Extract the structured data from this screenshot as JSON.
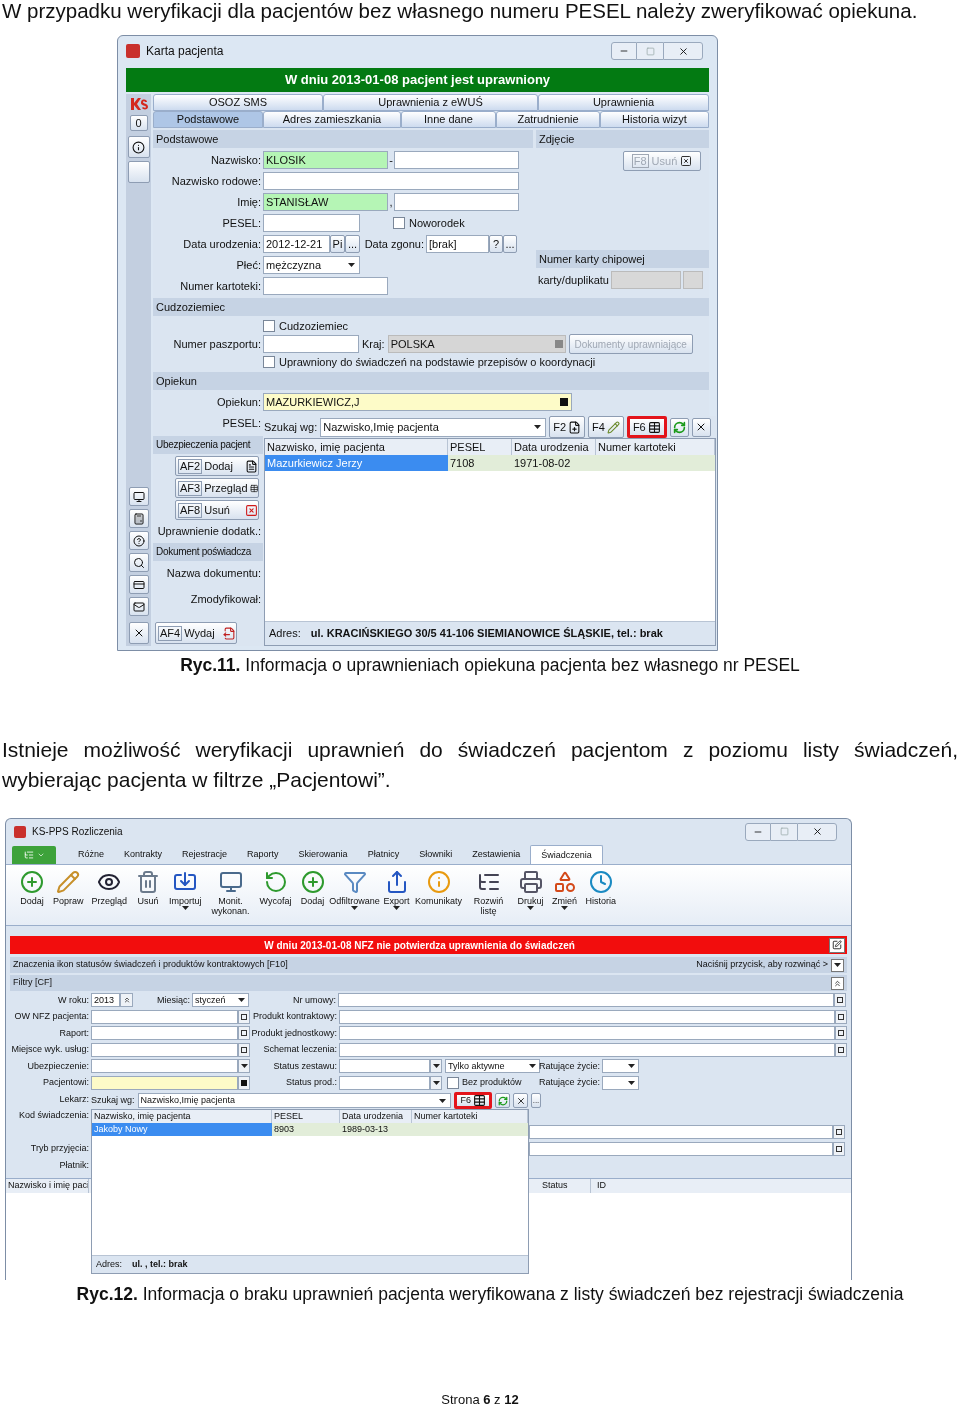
{
  "intro": "W przypadku weryfikacji dla pacjentów bez własnego numeru PESEL należy zweryfikować opiekuna.",
  "figure1": {
    "window": {
      "title": "Karta pacjenta"
    },
    "banner": {
      "kind": "ok",
      "text": "W dniu 2013-01-08 pacjent jest uprawniony"
    },
    "counter": "0",
    "tabs_row1": [
      {
        "label": "OSOZ SMS",
        "selected": false
      },
      {
        "label": "Uprawnienia z eWUŚ",
        "selected": false
      },
      {
        "label": "Uprawnienia",
        "selected": false
      }
    ],
    "tabs_row2": [
      {
        "label": "Podstawowe",
        "selected": true
      },
      {
        "label": "Adres zamieszkania",
        "selected": false
      },
      {
        "label": "Inne dane",
        "selected": false
      },
      {
        "label": "Zatrudnienie",
        "selected": false
      },
      {
        "label": "Historia wizyt",
        "selected": false
      }
    ],
    "basic": {
      "title": "Podstawowe",
      "surname": {
        "label": "Nazwisko:",
        "value": "KLOSIK",
        "separator": "-"
      },
      "birth_name": {
        "label": "Nazwisko rodowe:"
      },
      "first_name": {
        "label": "Imię:",
        "value": "STANISŁAW",
        "separator": ","
      },
      "pesel": {
        "label": "PESEL:"
      },
      "newborn": {
        "label": "Noworodek",
        "checked": false
      },
      "birth_date": {
        "label": "Data urodzenia:",
        "value": "2012-12-21",
        "button": "Pi",
        "more": "..."
      },
      "death_date": {
        "label": "Data zgonu:",
        "value": "[brak]",
        "button": "?",
        "more": "..."
      },
      "sex": {
        "label": "Płeć:",
        "value": "mężczyzna"
      },
      "file_number": {
        "label": "Numer kartoteki:"
      }
    },
    "photo": {
      "title": "Zdjęcie",
      "delete_button": {
        "key": "F8",
        "label": "Usuń",
        "disabled": true
      },
      "chip_title": "Numer karty chipowej",
      "chip_label": "karty/duplikatu"
    },
    "foreigner": {
      "title": "Cudzoziemiec",
      "checkbox": {
        "label": "Cudzoziemiec",
        "checked": false
      },
      "passport": {
        "label": "Numer paszportu:"
      },
      "country": {
        "label": "Kraj:",
        "value": "POLSKA"
      },
      "documents_button": {
        "label": "Dokumenty uprawniające",
        "disabled": true
      },
      "coordination": {
        "label": "Uprawniony do świadczeń na podstawie przepisów o koordynacji",
        "checked": false
      }
    },
    "guardian": {
      "title": "Opiekun",
      "label": "Opiekun:",
      "value": "MAZURKIEWICZ,J",
      "pesel_label": "PESEL:"
    },
    "insurance": {
      "title": "Ubezpieczenia pacjent",
      "buttons": [
        {
          "key": "AF2",
          "label": "Dodaj",
          "kind": "add"
        },
        {
          "key": "AF3",
          "label": "Przegląd",
          "kind": "view"
        },
        {
          "key": "AF8",
          "label": "Usuń",
          "kind": "delete"
        }
      ],
      "extra_label": "Uprawnienie dodatk.:"
    },
    "document": {
      "title": "Dokument poświadcza",
      "name_label": "Nazwa dokumentu:",
      "modified_label": "Zmodyfikował:"
    },
    "issue_button": {
      "key": "AF4",
      "label": "Wydaj"
    },
    "lookup": {
      "search_label": "Szukaj wg:",
      "search_value": "Nazwisko,Imię pacjenta",
      "buttons": [
        {
          "key": "F2",
          "kind": "new",
          "highlighted": false
        },
        {
          "key": "F4",
          "kind": "edit",
          "highlighted": false
        },
        {
          "key": "F6",
          "kind": "grid",
          "highlighted": true
        }
      ],
      "columns": [
        "Nazwisko, imię pacjenta",
        "PESEL",
        "Data urodzenia",
        "Numer kartoteki"
      ],
      "rows": [
        {
          "cells": [
            "Mazurkiewicz Jerzy",
            "7108",
            "1971-08-02"
          ],
          "selected": true
        }
      ],
      "address": {
        "label": "Adres:",
        "value": "ul. KRACIŃSKIEGO 30/5 41-106 SIEMIANOWICE ŚLĄSKIE, tel.: brak"
      }
    }
  },
  "caption1": "**Ryc.11.** Informacja o uprawnieniach opiekuna pacjenta bez własnego nr PESEL",
  "paragraph": "Istnieje możliwość weryfikacji uprawnień do świadczeń pacjentom z poziomu listy świadczeń, wybierając pacjenta w filtrze „Pacjentowi”.",
  "figure2": {
    "window": {
      "title": "KS-PPS Rozliczenia"
    },
    "ribbon_tabs": [
      {
        "label": "Różne",
        "selected": false
      },
      {
        "label": "Kontrakty",
        "selected": false
      },
      {
        "label": "Rejestracje",
        "selected": false
      },
      {
        "label": "Raporty",
        "selected": false
      },
      {
        "label": "Skierowania",
        "selected": false
      },
      {
        "label": "Płatnicy",
        "selected": false
      },
      {
        "label": "Słowniki",
        "selected": false
      },
      {
        "label": "Zestawienia",
        "selected": false
      },
      {
        "label": "Świadczenia",
        "selected": true
      }
    ],
    "toolbar": [
      {
        "label": "Dodaj",
        "kind": "add",
        "menu": false
      },
      {
        "label": "Popraw",
        "kind": "edit",
        "menu": false
      },
      {
        "label": "Przegląd",
        "kind": "view",
        "menu": false
      },
      {
        "label": "Usuń",
        "kind": "trash",
        "menu": false
      },
      {
        "label": "Importuj",
        "kind": "import",
        "menu": true
      },
      {
        "label": "Monit. wykonan.",
        "kind": "monitor",
        "menu": false
      },
      {
        "label": "Wycofaj",
        "kind": "undo",
        "menu": false
      },
      {
        "label": "Dodaj",
        "kind": "add",
        "menu": false
      },
      {
        "label": "Odfiltrowane",
        "kind": "filter",
        "menu": true
      },
      {
        "label": "Export",
        "kind": "export",
        "menu": true
      },
      {
        "label": "Komunikaty",
        "kind": "info",
        "menu": false
      },
      {
        "label": "Rozwiń listę",
        "kind": "expand",
        "menu": false
      },
      {
        "label": "Drukuj",
        "kind": "print",
        "menu": true
      },
      {
        "label": "Zmień",
        "kind": "change",
        "menu": true
      },
      {
        "label": "Historia",
        "kind": "history",
        "menu": false
      }
    ],
    "banner": {
      "kind": "warning",
      "text": "W dniu 2013-01-08 NFZ nie potwierdza uprawnienia do świadczeń"
    },
    "legend_bar": {
      "text": "Znaczenia ikon statusów świadczeń i produktów kontraktowych [F10]",
      "hint": "Naciśnij przycisk, aby rozwinąć >"
    },
    "filters": {
      "title": "Filtry [CF]",
      "year": {
        "label": "W roku:",
        "value": "2013"
      },
      "month": {
        "label": "Miesiąc:",
        "value": "styczeń"
      },
      "left_fields": [
        {
          "label": "OW NFZ pacjenta:",
          "kind": "pick"
        },
        {
          "label": "Raport:",
          "kind": "pick"
        },
        {
          "label": "Miejsce wyk. usług:",
          "kind": "pick"
        },
        {
          "label": "Ubezpieczenie:",
          "kind": "drop"
        },
        {
          "label": "Pacjentowi:",
          "kind": "patient"
        }
      ],
      "right_fields": [
        {
          "label": "Nr umowy:",
          "kind": "pick"
        },
        {
          "label": "Produkt kontraktowy:",
          "kind": "pick"
        },
        {
          "label": "Produkt jednostkowy:",
          "kind": "pick"
        },
        {
          "label": "Schemat leczenia:",
          "kind": "pick"
        },
        {
          "label": "Status zestawu:",
          "kind": "drop"
        },
        {
          "label": "Status prod.:",
          "kind": "drop"
        }
      ],
      "active_select": "Tylko aktywne",
      "without_products": {
        "label": "Bez produktów",
        "checked": false
      },
      "life_saving": [
        "Ratujące życie:",
        "Ratujące życie:"
      ],
      "lower_labels": [
        "Lekarz:",
        "Kod świadczenia:",
        "Tryb przyjęcia:",
        "Płatnik:"
      ]
    },
    "grid_columns": [
      "Nazwisko i imię paci",
      "Status",
      "ID"
    ],
    "lookup": {
      "search_label": "Szukaj wg:",
      "search_value": "Nazwisko,Imię pacjenta",
      "buttons": [
        {
          "key": "F6",
          "kind": "grid",
          "highlighted": true
        }
      ],
      "more": "...",
      "columns": [
        "Nazwisko, imię pacjenta",
        "PESEL",
        "Data urodzenia",
        "Numer kartoteki"
      ],
      "rows": [
        {
          "cells": [
            "Jakoby Nowy",
            "8903",
            "1989-03-13"
          ],
          "selected": true
        }
      ],
      "address": {
        "label": "Adres:",
        "value": "ul.  , tel.: brak"
      }
    }
  },
  "caption2": "**Ryc.12.** Informacja o braku uprawnień pacjenta weryfikowana z listy świadczeń bez rejestracji świadczenia",
  "footer": "Strona **6** z **12**"
}
